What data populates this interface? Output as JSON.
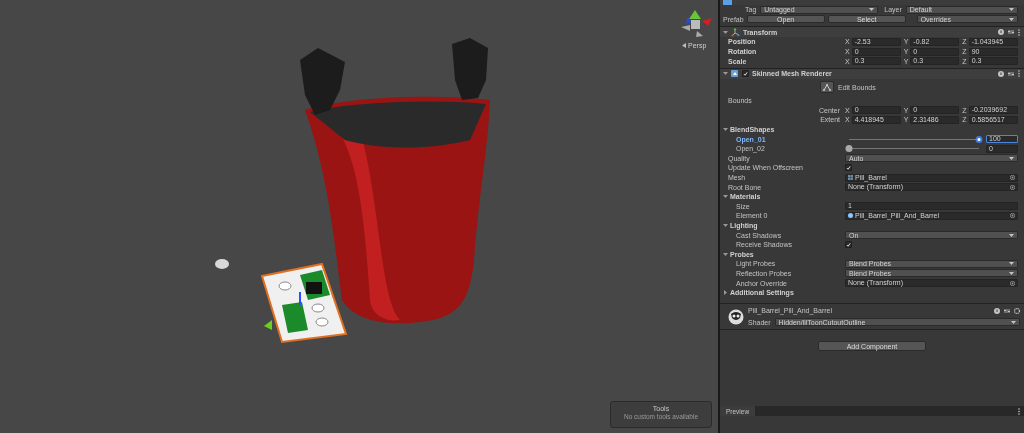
{
  "scene": {
    "view_mode": "Persp",
    "tools_overlay": {
      "title": "Tools",
      "message": "No custom tools available"
    }
  },
  "inspector": {
    "header": {
      "tag_label": "Tag",
      "tag": "Untagged",
      "layer_label": "Layer",
      "layer": "Default",
      "prefab_label": "Prefab",
      "prefab_buttons": [
        "Open",
        "Select"
      ],
      "overrides": "Overrides"
    },
    "components": [
      {
        "kind": "transform",
        "title": "Transform",
        "expanded": true,
        "rows": [
          {
            "kind": "vector",
            "label": "Position",
            "fields": [
              {
                "axis": "X",
                "value": "-2.53"
              },
              {
                "axis": "Y",
                "value": "-0.82"
              },
              {
                "axis": "Z",
                "value": "-1.043945"
              }
            ]
          },
          {
            "kind": "vector",
            "label": "Rotation",
            "fields": [
              {
                "axis": "X",
                "value": "0"
              },
              {
                "axis": "Y",
                "value": "0"
              },
              {
                "axis": "Z",
                "value": "90"
              }
            ]
          },
          {
            "kind": "vector",
            "label": "Scale",
            "fields": [
              {
                "axis": "X",
                "value": "0.3"
              },
              {
                "axis": "Y",
                "value": "0.3"
              },
              {
                "axis": "Z",
                "value": "0.3"
              }
            ]
          }
        ]
      },
      {
        "kind": "renderer",
        "title": "Skinned Mesh Renderer",
        "enabled": true,
        "expanded": true,
        "rows": [
          {
            "kind": "button",
            "label": "Edit Bounds"
          },
          {
            "kind": "label",
            "label": "Bounds"
          },
          {
            "kind": "subvector",
            "label": "Center",
            "fields": [
              {
                "axis": "X",
                "value": "0"
              },
              {
                "axis": "Y",
                "value": "0"
              },
              {
                "axis": "Z",
                "value": "-0.2039692"
              }
            ]
          },
          {
            "kind": "subvector",
            "label": "Extent",
            "fields": [
              {
                "axis": "X",
                "value": "4.418945"
              },
              {
                "axis": "Y",
                "value": "2.31486"
              },
              {
                "axis": "Z",
                "value": "0.5856517"
              }
            ]
          },
          {
            "kind": "foldout",
            "label": "BlendShapes",
            "expanded": true,
            "children": [
              {
                "kind": "slider",
                "label": "Open_01",
                "level": 1,
                "value": "100",
                "selected": true
              },
              {
                "kind": "slider",
                "label": "Open_02",
                "level": 0,
                "value": "0",
                "selected": false
              }
            ]
          },
          {
            "kind": "dropdown",
            "label": "Quality",
            "value": "Auto"
          },
          {
            "kind": "checkbox",
            "label": "Update When Offscreen",
            "checked": true
          },
          {
            "kind": "mesh-object",
            "label": "Mesh",
            "value": "Pill_Barrel"
          },
          {
            "kind": "object",
            "label": "Root Bone",
            "value": "None (Transform)"
          },
          {
            "kind": "foldout",
            "label": "Materials",
            "expanded": true,
            "children": [
              {
                "kind": "text",
                "label": "Size",
                "value": "1"
              },
              {
                "kind": "material-object",
                "label": "Element 0",
                "value": "Pill_Barrel_Pill_And_Barrel"
              }
            ]
          },
          {
            "kind": "foldout",
            "label": "Lighting",
            "expanded": true,
            "children": [
              {
                "kind": "dropdown",
                "label": "Cast Shadows",
                "value": "On"
              },
              {
                "kind": "checkbox",
                "label": "Receive Shadows",
                "checked": true
              }
            ]
          },
          {
            "kind": "foldout",
            "label": "Probes",
            "expanded": true,
            "children": [
              {
                "kind": "dropdown",
                "label": "Light Probes",
                "value": "Blend Probes"
              },
              {
                "kind": "dropdown",
                "label": "Reflection Probes",
                "value": "Blend Probes"
              },
              {
                "kind": "object",
                "label": "Anchor Override",
                "value": "None (Transform)"
              }
            ]
          },
          {
            "kind": "foldout",
            "label": "Additional Settings",
            "expanded": false,
            "children": []
          }
        ]
      },
      {
        "kind": "material",
        "title": "Pill_Barrel_Pill_And_Barrel",
        "shader_label": "Shader",
        "shader": "Hidden/lilToonCutoutOutline"
      }
    ],
    "add_component_button": "Add Component",
    "preview_tab": "Preview"
  }
}
